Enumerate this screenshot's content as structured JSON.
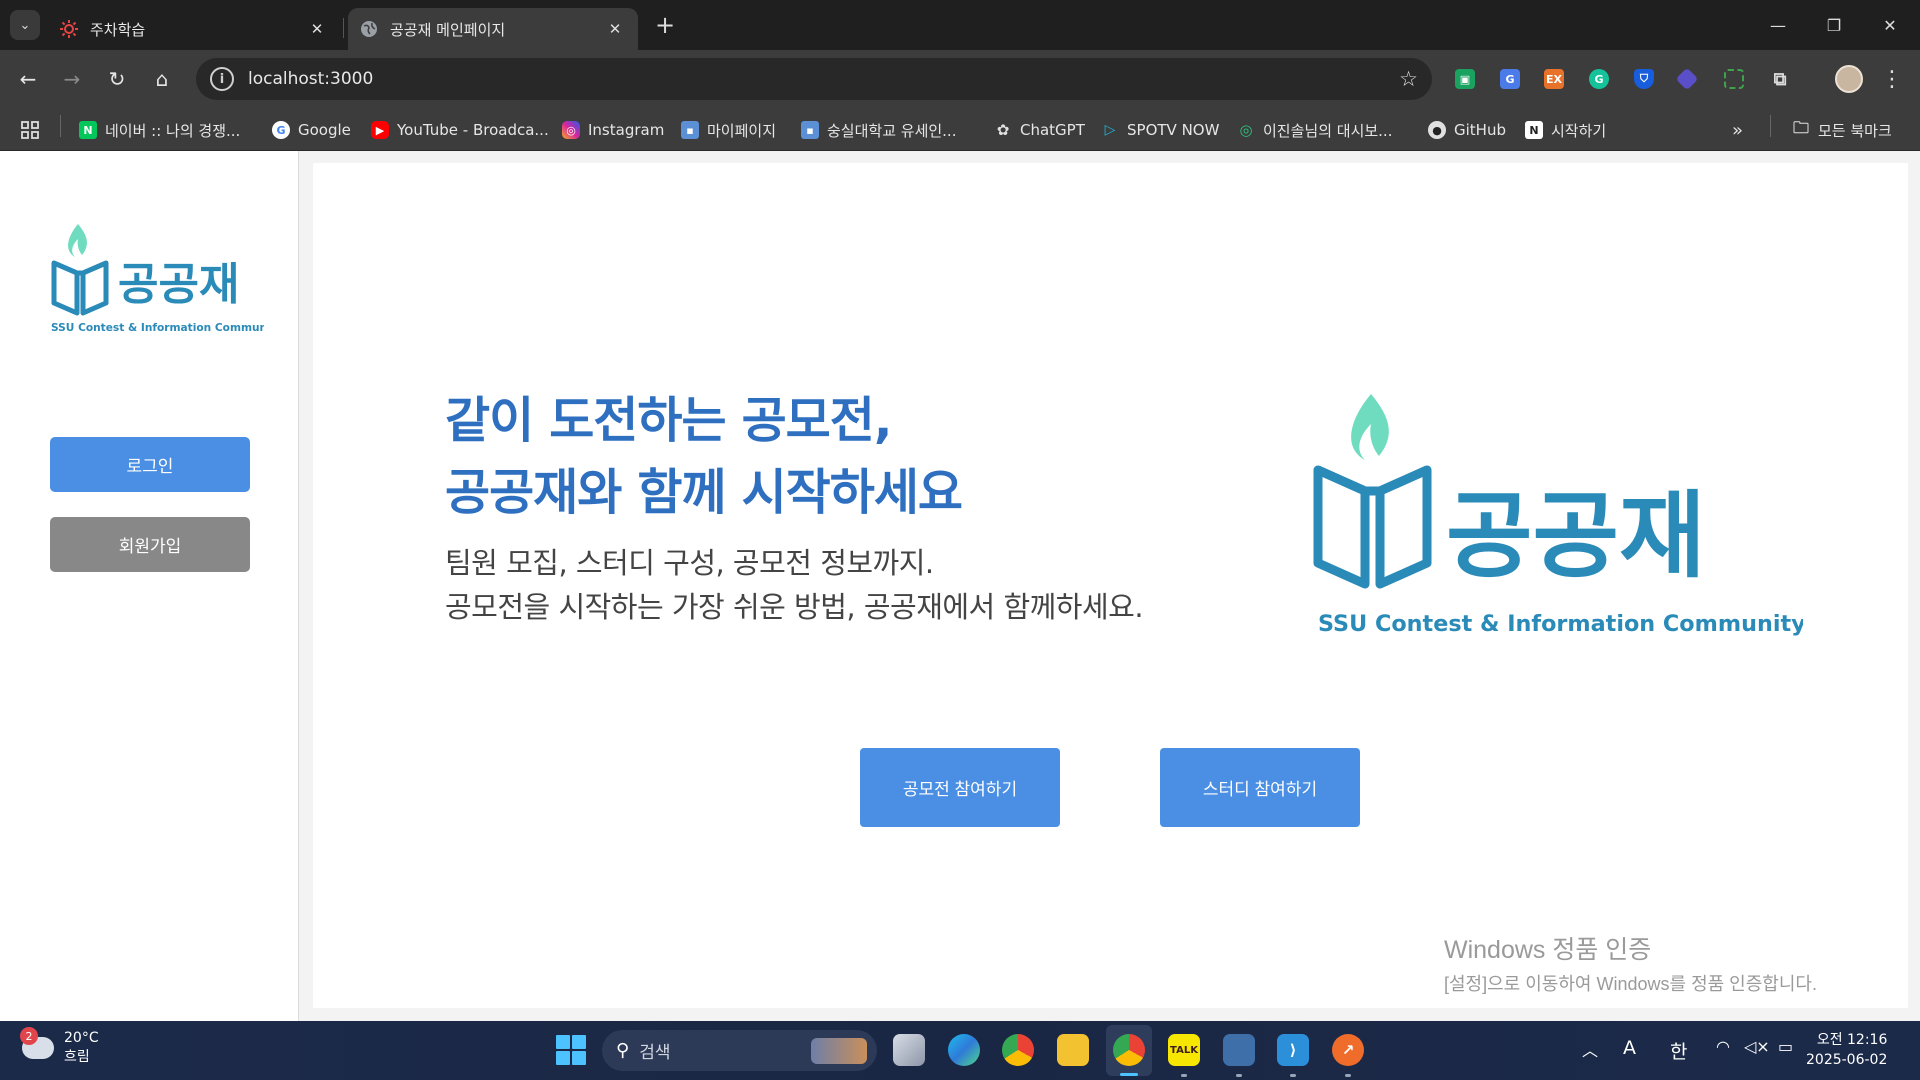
{
  "browser": {
    "tabs": [
      {
        "title": "주차학습",
        "active": false
      },
      {
        "title": "공공재 메인페이지",
        "active": true
      }
    ],
    "url": "localhost:3000",
    "bookmarks": [
      {
        "label": "네이버 :: 나의 경쟁...",
        "icon": "naver-icon",
        "color": "#03c75a"
      },
      {
        "label": "Google",
        "icon": "google-icon",
        "color": "#4285f4"
      },
      {
        "label": "YouTube - Broadca...",
        "icon": "youtube-icon",
        "color": "#ff0000"
      },
      {
        "label": "Instagram",
        "icon": "instagram-icon",
        "color": "#d6249f"
      },
      {
        "label": "마이페이지",
        "icon": "mypage-icon",
        "color": "#5b8fd6"
      },
      {
        "label": "숭실대학교 유세인...",
        "icon": "ssu-icon",
        "color": "#5b8fd6"
      },
      {
        "label": "ChatGPT",
        "icon": "chatgpt-icon",
        "color": "#e0e0e0"
      },
      {
        "label": "SPOTV NOW",
        "icon": "spotv-icon",
        "color": "#1fb6d8"
      },
      {
        "label": "이진솔님의 대시보...",
        "icon": "dashboard-icon",
        "color": "#2ec27e"
      },
      {
        "label": "GitHub",
        "icon": "github-icon",
        "color": "#e0e0e0"
      },
      {
        "label": "시작하기",
        "icon": "notion-icon",
        "color": "#e0e0e0"
      }
    ],
    "all_bookmarks_label": "모든 북마크"
  },
  "sidebar": {
    "logo_text": "공공재",
    "logo_tagline": "SSU Contest & Information Community",
    "login_label": "로그인",
    "signup_label": "회원가입"
  },
  "hero": {
    "headline_line1": "같이 도전하는 공모전,",
    "headline_line2": "공공재와 함께 시작하세요",
    "sub_line1": "팀원 모집, 스터디 구성, 공모전 정보까지.",
    "sub_line2": "공모전을 시작하는 가장 쉬운 방법, 공공재에서 함께하세요.",
    "logo_text": "공공재",
    "logo_tagline": "SSU Contest & Information Community"
  },
  "actions": {
    "contest_label": "공모전 참여하기",
    "study_label": "스터디 참여하기"
  },
  "watermark": {
    "line1": "Windows 정품 인증",
    "line2": "[설정]으로 이동하여 Windows를 정품 인증합니다."
  },
  "taskbar": {
    "weather_badge": "2",
    "temperature": "20°C",
    "condition": "흐림",
    "search_label": "검색",
    "ime_mode": "A",
    "ime_lang": "한",
    "time": "오전 12:16",
    "date": "2025-06-02"
  },
  "colors": {
    "brand_blue": "#2f6fc0",
    "logo_blue": "#2a8ab8",
    "flame_mint": "#6fdcc0",
    "button_blue": "#4a8fe4",
    "button_gray": "#888888"
  }
}
